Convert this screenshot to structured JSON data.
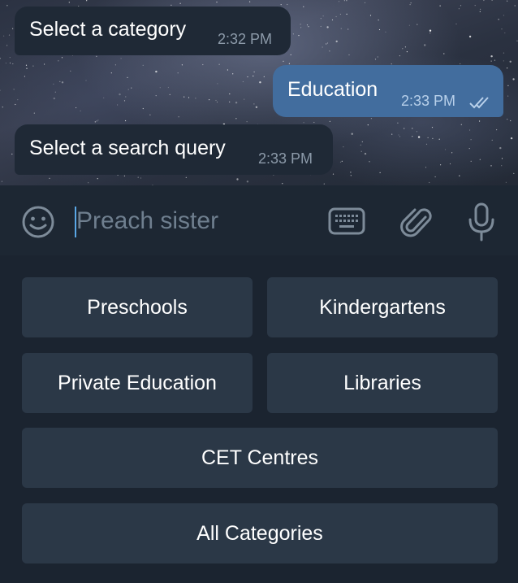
{
  "messages": [
    {
      "direction": "incoming",
      "text": "Select a category",
      "time": "2:32 PM"
    },
    {
      "direction": "outgoing",
      "text": "Education",
      "time": "2:33 PM",
      "status": "read"
    },
    {
      "direction": "incoming",
      "text": "Select a search query",
      "time": "2:33 PM"
    }
  ],
  "composer": {
    "placeholder": "Preach sister",
    "value": "",
    "icons": [
      "emoji-icon",
      "keyboard-icon",
      "paperclip-icon",
      "microphone-icon"
    ]
  },
  "bot_keyboard": {
    "buttons": [
      "Preschools",
      "Kindergartens",
      "Private Education",
      "Libraries",
      "CET Centres",
      "All Categories"
    ]
  },
  "colors": {
    "background": "#1d2733",
    "incoming_bubble": "#1f2936",
    "outgoing_bubble": "#426d9e",
    "keyboard_button": "#2b3847",
    "accent": "#5aa7e6"
  }
}
